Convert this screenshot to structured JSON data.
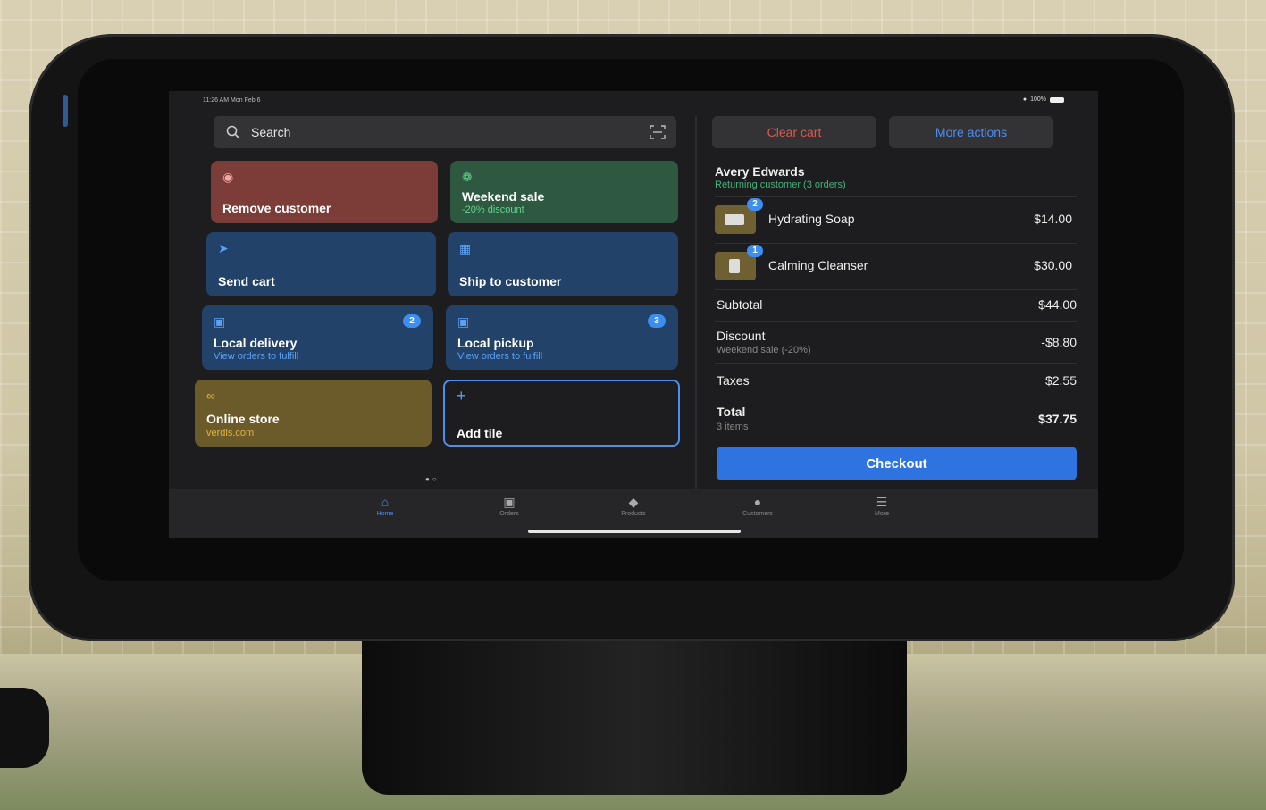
{
  "status_bar": {
    "time_date": "11:26 AM Mon Feb 6",
    "battery": "100%"
  },
  "search": {
    "placeholder": "Search"
  },
  "tiles": [
    {
      "title": "Remove customer",
      "subtitle": "",
      "icon": "person-icon",
      "color": "#7c3c37"
    },
    {
      "title": "Weekend sale",
      "subtitle": "-20% discount",
      "icon": "gear-icon",
      "color": "#2e5840"
    },
    {
      "title": "Send cart",
      "subtitle": "",
      "icon": "send-icon",
      "color": "#22426a"
    },
    {
      "title": "Ship to customer",
      "subtitle": "",
      "icon": "package-icon",
      "color": "#22426a"
    },
    {
      "title": "Local delivery",
      "subtitle": "View orders to fulfill",
      "icon": "truck-icon",
      "badge": "2",
      "color": "#22426a"
    },
    {
      "title": "Local pickup",
      "subtitle": "View orders to fulfill",
      "icon": "inbox-icon",
      "badge": "3",
      "color": "#22426a"
    },
    {
      "title": "Online store",
      "subtitle": "verdis.com",
      "icon": "link-icon",
      "color": "#6b5a2a"
    },
    {
      "title": "Add tile",
      "subtitle": "",
      "icon": "plus-icon",
      "color": "#4b8ff0"
    }
  ],
  "cart": {
    "clear_label": "Clear cart",
    "more_label": "More actions",
    "customer_name": "Avery Edwards",
    "customer_sub": "Returning customer (3 orders)",
    "items": [
      {
        "name": "Hydrating Soap",
        "price": "$14.00",
        "qty": "2"
      },
      {
        "name": "Calming Cleanser",
        "price": "$30.00",
        "qty": "1"
      }
    ],
    "subtotal_label": "Subtotal",
    "subtotal": "$44.00",
    "discount_label": "Discount",
    "discount_sub": "Weekend sale (-20%)",
    "discount": "-$8.80",
    "taxes_label": "Taxes",
    "taxes": "$2.55",
    "total_label": "Total",
    "total_sub": "3 items",
    "total": "$37.75",
    "checkout_label": "Checkout"
  },
  "tabs": [
    {
      "label": "Home",
      "icon": "home-icon",
      "active": true
    },
    {
      "label": "Orders",
      "icon": "orders-icon",
      "active": false
    },
    {
      "label": "Products",
      "icon": "tag-icon",
      "active": false
    },
    {
      "label": "Customers",
      "icon": "person-icon",
      "active": false
    },
    {
      "label": "More",
      "icon": "menu-icon",
      "active": false
    }
  ],
  "colors": {
    "accent": "#2f73e0",
    "clear": "#e0574a",
    "more": "#4a8df0",
    "success": "#3fb27a"
  }
}
